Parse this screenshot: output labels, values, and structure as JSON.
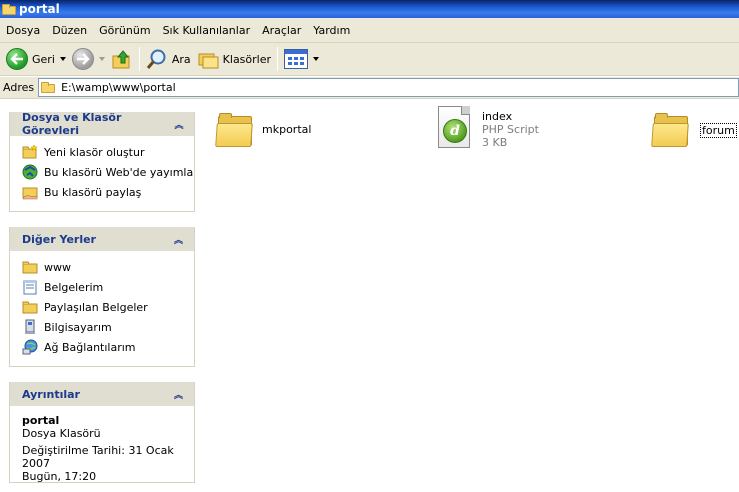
{
  "window": {
    "title": "portal"
  },
  "menu": {
    "items": [
      "Dosya",
      "Düzen",
      "Görünüm",
      "Sık Kullanılanlar",
      "Araçlar",
      "Yardım"
    ]
  },
  "toolbar": {
    "back_label": "Geri",
    "search_label": "Ara",
    "folders_label": "Klasörler"
  },
  "address": {
    "label": "Adres",
    "value": "E:\\wamp\\www\\portal"
  },
  "tasks_panel": {
    "title": "Dosya ve Klasör Görevleri",
    "items": [
      {
        "label": "Yeni klasör oluştur",
        "icon": "new-folder-icon"
      },
      {
        "label": "Bu klasörü Web'de yayımla",
        "icon": "publish-web-icon"
      },
      {
        "label": "Bu klasörü paylaş",
        "icon": "share-folder-icon"
      }
    ]
  },
  "places_panel": {
    "title": "Diğer Yerler",
    "items": [
      {
        "label": "www",
        "icon": "folder-icon"
      },
      {
        "label": "Belgelerim",
        "icon": "my-documents-icon"
      },
      {
        "label": "Paylaşılan Belgeler",
        "icon": "shared-folder-icon"
      },
      {
        "label": "Bilgisayarım",
        "icon": "computer-icon"
      },
      {
        "label": "Ağ Bağlantılarım",
        "icon": "network-icon"
      }
    ]
  },
  "details_panel": {
    "title": "Ayrıntılar",
    "name": "portal",
    "type": "Dosya Klasörü",
    "modified_line1": "Değiştirilme Tarihi: 31 Ocak 2007",
    "modified_line2": "Bugün, 17:20"
  },
  "files": [
    {
      "name": "mkportal",
      "kind": "folder"
    },
    {
      "name": "index",
      "type": "PHP Script",
      "size": "3 KB",
      "kind": "php"
    },
    {
      "name": "forum",
      "kind": "folder"
    }
  ],
  "colors": {
    "title_bar": "#1c5cd6",
    "panel_header": "#e0ddd1",
    "panel_title": "#1a3a8a",
    "chrome": "#ece9d8"
  }
}
